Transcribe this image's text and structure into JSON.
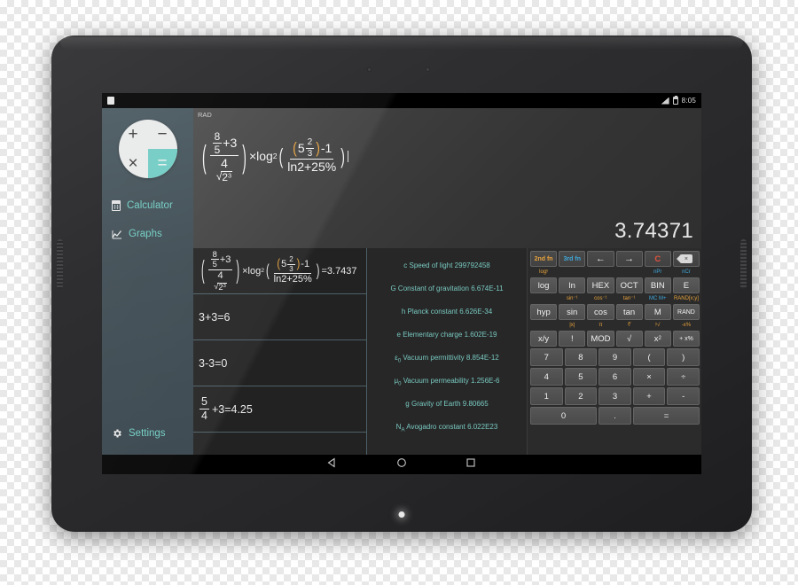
{
  "status_bar": {
    "app_icon": "calculator-app-icon",
    "wifi_icon": "wifi-icon",
    "battery_icon": "battery-icon",
    "time": "8:05"
  },
  "sidebar": {
    "logo": {
      "plus": "+",
      "minus": "−",
      "times": "×",
      "equals": "="
    },
    "items": [
      {
        "label": "Calculator",
        "icon": "calculator-icon"
      },
      {
        "label": "Graphs",
        "icon": "graph-icon"
      }
    ],
    "settings": {
      "label": "Settings",
      "icon": "gear-icon"
    },
    "accent_color": "#6fccc3",
    "background_color": "#3b4950"
  },
  "display": {
    "angle_mode": "RAD",
    "expression_text": "((8/5+3)/(4/√2³))×log₂(((5 2/3)-1)/(ln2+25%))",
    "expression_parts": {
      "n1": "8",
      "d1": "5",
      "plus3": "+3",
      "n2": "4",
      "sqrt_base": "2",
      "sqrt_exp": "3",
      "mult_log": "×log",
      "log_base": "2",
      "mixed_whole": "5",
      "mixed_num": "2",
      "mixed_den": "3",
      "minus1": "-1",
      "denom2": "ln2+25%"
    },
    "result": "3.74371"
  },
  "history": [
    {
      "type": "formula",
      "result": "=3.7437"
    },
    {
      "type": "plain",
      "text": "3+3=6"
    },
    {
      "type": "plain",
      "text": "3-3=0"
    },
    {
      "type": "fraction",
      "num": "5",
      "den": "4",
      "rest": "+3=4.25"
    }
  ],
  "constants": [
    {
      "symbol": "c",
      "sub": "",
      "name": "Speed of light",
      "value": "299792458"
    },
    {
      "symbol": "G",
      "sub": "",
      "name": "Constant of gravitation",
      "value": "6.674E-11"
    },
    {
      "symbol": "h",
      "sub": "",
      "name": "Planck constant",
      "value": "6.626E-34"
    },
    {
      "symbol": "e",
      "sub": "",
      "name": "Elementary charge",
      "value": "1.602E-19"
    },
    {
      "symbol": "ε",
      "sub": "0",
      "name": "Vacuum permittivity",
      "value": "8.854E-12"
    },
    {
      "symbol": "μ",
      "sub": "0",
      "name": "Vacuum permeability",
      "value": "1.256E-6"
    },
    {
      "symbol": "g",
      "sub": "",
      "name": "Gravity of Earth",
      "value": "9.80665"
    },
    {
      "symbol": "N",
      "sub": "A",
      "name": "Avogadro constant",
      "value": "6.022E23"
    }
  ],
  "keypad": {
    "row0_labels": [
      "logʸ",
      "",
      "",
      "",
      "nPr",
      "nCr"
    ],
    "row0_label_colors": [
      "orange",
      "",
      "",
      "",
      "blue",
      "blue"
    ],
    "row0": [
      "2nd fn",
      "3rd fn",
      "←",
      "→",
      "C",
      "⌫"
    ],
    "row1_labels": [
      "",
      "",
      "",
      "",
      "",
      ""
    ],
    "row1": [
      "log",
      "ln",
      "HEX",
      "OCT",
      "BIN",
      "E"
    ],
    "row2_labels": [
      "",
      "sin⁻¹",
      "cos⁻¹",
      "tan⁻¹",
      "MC   M+",
      "RAND[x;y]"
    ],
    "row2": [
      "hyp",
      "sin",
      "cos",
      "tan",
      "M",
      "RAND"
    ],
    "row3_labels": [
      "",
      "|x|",
      "π",
      "∛",
      "ʸ√",
      "-x%"
    ],
    "row3": [
      "x/y",
      "!",
      "MOD",
      "√",
      "x²",
      "+ x%"
    ],
    "row4": [
      "7",
      "8",
      "9",
      "(",
      ")"
    ],
    "row5": [
      "4",
      "5",
      "6",
      "×",
      "÷"
    ],
    "row6": [
      "1",
      "2",
      "3",
      "+",
      "-"
    ],
    "row7": [
      "0",
      ".",
      "="
    ],
    "colors": {
      "second_fn": "#e8a33d",
      "third_fn": "#3fa9dd",
      "clear": "#e0523e"
    }
  },
  "navbar": {
    "back": "back-button",
    "home": "home-button",
    "recents": "recents-button"
  }
}
